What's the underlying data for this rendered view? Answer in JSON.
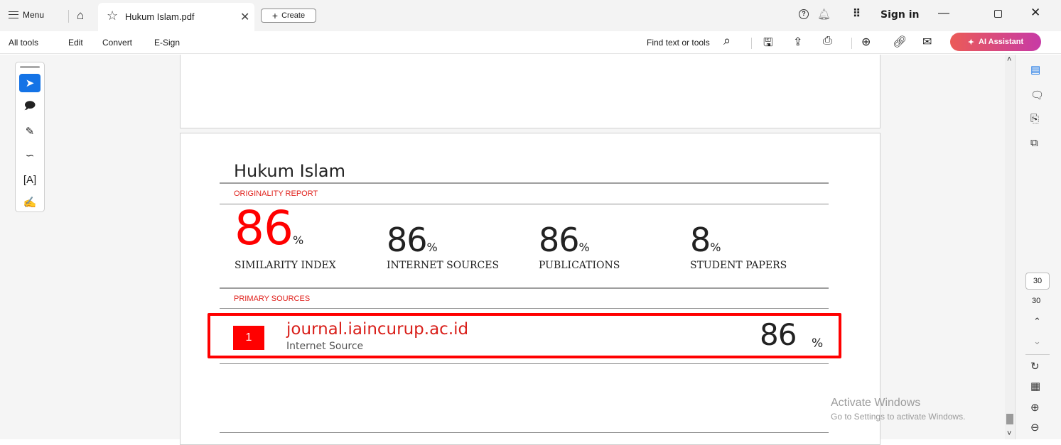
{
  "titlebar": {
    "menu_label": "Menu",
    "tab_title": "Hukum Islam.pdf",
    "create_label": "Create",
    "sign_in": "Sign in"
  },
  "toolbar": {
    "items": [
      "All tools",
      "Edit",
      "Convert",
      "E-Sign"
    ],
    "find_label": "Find text or tools",
    "ai_label": "AI Assistant"
  },
  "icons": {
    "left_rail": [
      "select-icon",
      "add-comment-icon",
      "pen-icon",
      "lasso-icon",
      "text-recognize-icon",
      "sign-icon"
    ],
    "right_rail": [
      "edit-pdf-icon",
      "comments-icon",
      "bookmarks-icon",
      "pages-icon",
      "rotate-icon",
      "page-display-icon",
      "zoom-in-icon",
      "zoom-out-icon"
    ]
  },
  "report": {
    "title": "Hukum Islam",
    "originality_label": "ORIGINALITY REPORT",
    "metrics": [
      {
        "value": "86",
        "unit": "%",
        "caption": "SIMILARITY INDEX"
      },
      {
        "value": "86",
        "unit": "%",
        "caption": "INTERNET SOURCES"
      },
      {
        "value": "86",
        "unit": "%",
        "caption": "PUBLICATIONS"
      },
      {
        "value": "8",
        "unit": "%",
        "caption": "STUDENT PAPERS"
      }
    ],
    "primary_label": "PRIMARY SOURCES",
    "source": {
      "rank": "1",
      "name": "journal.iaincurup.ac.id",
      "type": "Internet Source",
      "value": "86",
      "unit": "%"
    }
  },
  "navigation": {
    "current_page": "30",
    "total_pages": "30"
  },
  "watermark": {
    "title": "Activate Windows",
    "subtitle": "Go to Settings to activate Windows."
  },
  "colors": {
    "accent_red": "#ff0000",
    "select_blue": "#1473e6"
  }
}
